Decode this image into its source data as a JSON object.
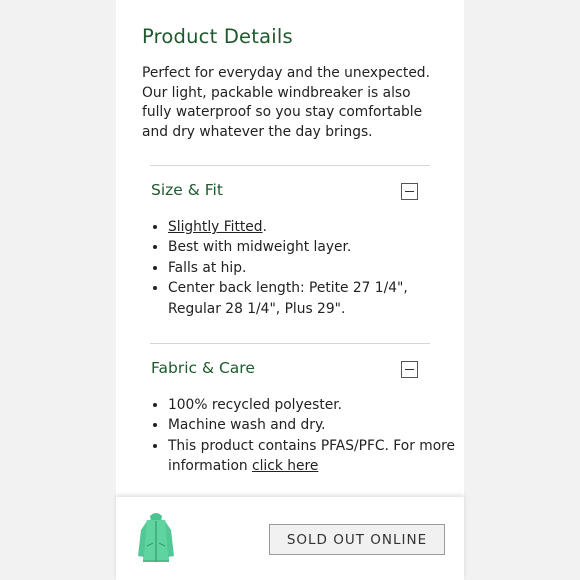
{
  "product_details": {
    "title": "Product Details",
    "description": "Perfect for everyday and the unexpected. Our light, packable windbreaker is also fully waterproof so you stay comfortable and dry whatever the day brings."
  },
  "size_fit": {
    "heading": "Size & Fit",
    "toggle_icon": "minus-box-icon",
    "items": [
      {
        "link": "Slightly Fitted",
        "suffix": "."
      },
      {
        "text": "Best with midweight layer."
      },
      {
        "text": "Falls at hip."
      },
      {
        "text": "Center back length: Petite 27 1/4\", Regular 28 1/4\", Plus 29\"."
      }
    ]
  },
  "fabric_care": {
    "heading": "Fabric & Care",
    "toggle_icon": "minus-box-icon",
    "items": [
      {
        "text": "100% recycled polyester."
      },
      {
        "text": "Machine wash and dry."
      },
      {
        "text": "This product contains PFAS/PFC. For more information ",
        "link": "click here"
      }
    ]
  },
  "bottom_bar": {
    "thumbnail": "jacket-thumbnail",
    "button_label": "SOLD OUT ONLINE"
  },
  "colors": {
    "heading_green": "#1f5a2e",
    "jacket_green": "#5fd3a0"
  }
}
